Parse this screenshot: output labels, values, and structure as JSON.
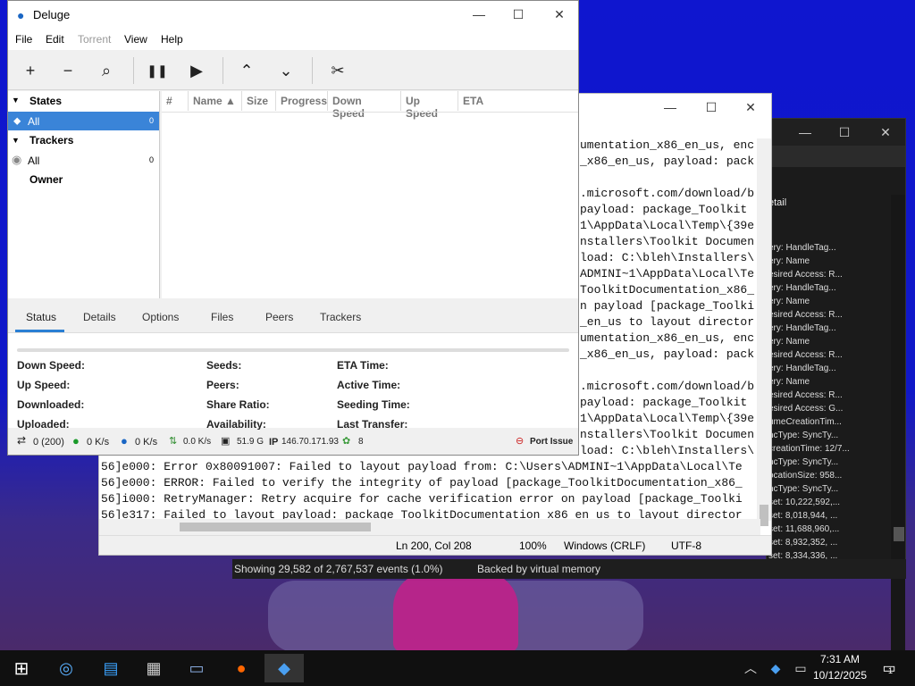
{
  "deluge": {
    "title": "Deluge",
    "menu": [
      "File",
      "Edit",
      "Torrent",
      "View",
      "Help"
    ],
    "toolbar": [
      "+",
      "−",
      "⌕",
      "❚❚",
      "▶",
      "⌃",
      "⌄",
      "✂"
    ],
    "states_label": "States",
    "states_all": "All",
    "states_all_count": "0",
    "trackers_label": "Trackers",
    "trackers_all": "All",
    "trackers_all_count": "0",
    "owner_label": "Owner",
    "columns": [
      "#",
      "Name ▲",
      "Size",
      "Progress",
      "Down Speed",
      "Up Speed",
      "ETA"
    ],
    "tabs": [
      "Status",
      "Details",
      "Options",
      "Files",
      "Peers",
      "Trackers"
    ],
    "details": {
      "c1": [
        "Down Speed:",
        "Up Speed:",
        "Downloaded:",
        "Uploaded:"
      ],
      "c2": [
        "Seeds:",
        "Peers:",
        "Share Ratio:",
        "Availability:"
      ],
      "c3": [
        "ETA Time:",
        "Active Time:",
        "Seeding Time:",
        "Last Transfer:"
      ]
    },
    "status": {
      "conn": "0 (200)",
      "down": "0 K/s",
      "up": "0 K/s",
      "proto": "0.0 K/s",
      "disk": "51.9 G",
      "ip_label": "IP",
      "ip": "146.70.171.93",
      "dht": "8",
      "port": "Port Issue"
    }
  },
  "notepad": {
    "lines_right": [
      "umentation_x86_en_us, enc",
      "_x86_en_us, payload: pack",
      "",
      ".microsoft.com/download/b",
      "payload: package_Toolkit",
      "1\\AppData\\Local\\Temp\\{39e",
      "nstallers\\Toolkit Documen",
      "load: C:\\bleh\\Installers\\",
      "ADMINI~1\\AppData\\Local\\Te",
      "ToolkitDocumentation_x86_",
      "n payload [package_Toolki",
      "_en_us to layout director",
      "umentation_x86_en_us, enc",
      "_x86_en_us, payload: pack",
      "",
      ".microsoft.com/download/b",
      "payload: package_Toolkit",
      "1\\AppData\\Local\\Temp\\{39e",
      "nstallers\\Toolkit Documen",
      "load: C:\\bleh\\Installers\\"
    ],
    "lines_full": [
      "56]e000: Error 0x80091007: Failed to layout payload from: C:\\Users\\ADMINI~1\\AppData\\Local\\Te",
      "56]e000: ERROR: Failed to verify the integrity of payload [package_ToolkitDocumentation_x86_",
      "56]i000: RetryManager: Retry acquire for cache verification error on payload [package_Toolki",
      "56]e317: Failed to layout payload: package_ToolkitDocumentation_x86_en_us to layout director"
    ],
    "position": "Ln 200, Col 208",
    "zoom": "100%",
    "eol": "Windows (CRLF)",
    "encoding": "UTF-8"
  },
  "events": {
    "showing": "Showing 29,582 of 2,767,537 events (1.0%)",
    "memory": "Backed by virtual memory"
  },
  "procmon": {
    "header": "etail",
    "rows": [
      "ery: HandleTag...",
      "ery: Name",
      "esired Access: R...",
      "ery: HandleTag...",
      "ery: Name",
      "esired Access: R...",
      "ery: HandleTag...",
      "ery: Name",
      "esired Access: R...",
      "ery: HandleTag...",
      "ery: Name",
      "esired Access: R...",
      "esired Access: G...",
      "umeCreationTim...",
      "ncType: SyncTy...",
      "creationTime: 12/7...",
      "ncType: SyncTy...",
      "ocationSize: 958...",
      "ncType: SyncTy...",
      "set: 10,222,592,...",
      "set: 8,018,944, ...",
      "set: 11,688,960,...",
      "set: 8,932,352, ...",
      "set: 8,334,336, ..."
    ]
  },
  "taskbar": {
    "time": "7:31 AM",
    "date": "10/12/2025",
    "notif": "1"
  }
}
